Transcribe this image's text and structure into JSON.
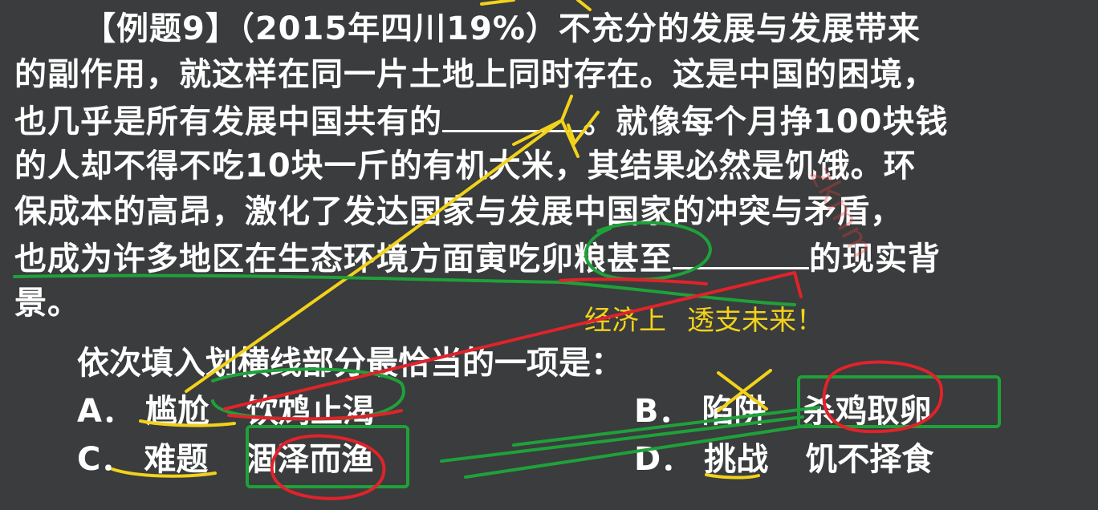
{
  "passage": {
    "lines": [
      "【例题9】（2015年四川19%）不充分的发展与发展带来",
      "的副作用，就这样在同一片土地上同时存在。这是中国的困境，",
      "也几乎是所有发展中国共有的",
      "。就像每个月挣100块钱",
      "的人却不得不吃10块一斤的有机大米，其结果必然是饥饿。环",
      "保成本的高昂，激化了发达国家与发展中国家的冲突与矛盾，",
      "也成为许多地区在生态环境方面寅吃卯粮甚至",
      "的现实背",
      "景。"
    ]
  },
  "question": "依次填入划横线部分最恰当的一项是：",
  "options": [
    {
      "letter": "A．",
      "word1": "尴尬",
      "word2": "饮鸩止渴"
    },
    {
      "letter": "B．",
      "word1": "陷阱",
      "word2": "杀鸡取卵"
    },
    {
      "letter": "C．",
      "word1": "难题",
      "word2": "涸泽而渔"
    },
    {
      "letter": "D．",
      "word1": "挑战",
      "word2": "饥不择食"
    }
  ],
  "annotation": {
    "note1": "经济上",
    "note2": "透支未来！"
  },
  "watermark": "zkmm",
  "colors": {
    "background": "#3a3c3d",
    "text": "#ffffff",
    "yellow_ink": "#f2d21b",
    "green_ink": "#1fa13a",
    "red_ink": "#e0232b"
  }
}
